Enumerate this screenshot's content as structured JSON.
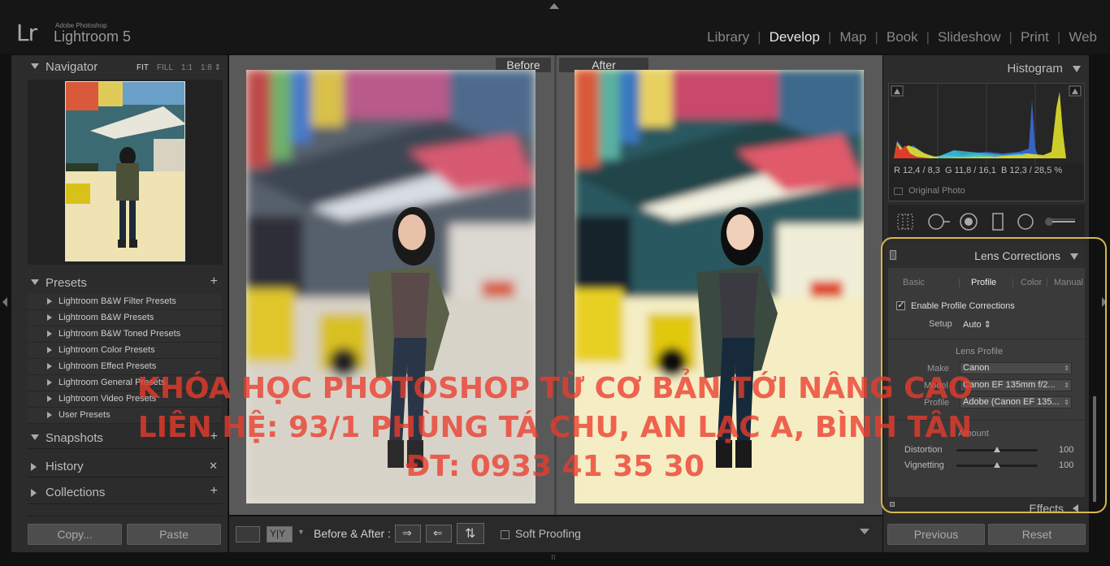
{
  "app": {
    "logo": "Lr",
    "brand_small": "Adobe Photoshop",
    "brand_name": "Lightroom 5"
  },
  "modules": [
    "Library",
    "Develop",
    "Map",
    "Book",
    "Slideshow",
    "Print",
    "Web"
  ],
  "active_module": "Develop",
  "navigator": {
    "title": "Navigator",
    "options": [
      "FIT",
      "FILL",
      "1:1",
      "1:8 ⇕"
    ],
    "active_option": "FIT"
  },
  "presets": {
    "title": "Presets",
    "items": [
      "Lightroom B&W Filter Presets",
      "Lightroom B&W Presets",
      "Lightroom B&W Toned Presets",
      "Lightroom Color Presets",
      "Lightroom Effect Presets",
      "Lightroom General Presets",
      "Lightroom Video Presets",
      "User Presets"
    ]
  },
  "left_sections": {
    "snapshots": "Snapshots",
    "history": "History",
    "collections": "Collections"
  },
  "left_buttons": {
    "copy": "Copy...",
    "paste": "Paste"
  },
  "view": {
    "before_label": "Before",
    "after_label": "After"
  },
  "toolbar": {
    "before_after_label": "Before & After :",
    "soft_proofing": "Soft Proofing"
  },
  "histogram": {
    "title": "Histogram",
    "r_label": "R",
    "r_value": "12,4 /  8,3",
    "g_label": "G",
    "g_value": "11,8 / 16,1",
    "b_label": "B",
    "b_value": "12,3 / 28,5",
    "percent": "%",
    "original_photo": "Original Photo"
  },
  "lens_corrections": {
    "title": "Lens Corrections",
    "tabs": [
      "Basic",
      "Profile",
      "Color",
      "Manual"
    ],
    "active_tab": "Profile",
    "enable_label": "Enable Profile Corrections",
    "enable_checked": true,
    "setup_label": "Setup",
    "setup_value": "Auto ⇕",
    "lens_profile_title": "Lens Profile",
    "make_label": "Make",
    "make_value": "Canon",
    "model_label": "Model",
    "model_value": "Canon EF 135mm f/2...",
    "profile_label": "Profile",
    "profile_value": "Adobe (Canon EF 135...",
    "amount_title": "Amount",
    "distortion_label": "Distortion",
    "distortion_value": "100",
    "vignetting_label": "Vignetting",
    "vignetting_value": "100"
  },
  "effects": {
    "title": "Effects"
  },
  "right_buttons": {
    "previous": "Previous",
    "reset": "Reset"
  },
  "watermark": {
    "line1": "KHÓA HỌC PHOTOSHOP TỪ CƠ BẢN TỚI NÂNG CAO",
    "line2": "LIÊN HỆ: 93/1 PHÙNG TÁ CHU, AN LẠC A, BÌNH TÂN",
    "line3": "ĐT: 0933 41 35 30"
  },
  "colors": {
    "accent_outline": "#d8b84a",
    "watermark": "#eb3c2d"
  }
}
